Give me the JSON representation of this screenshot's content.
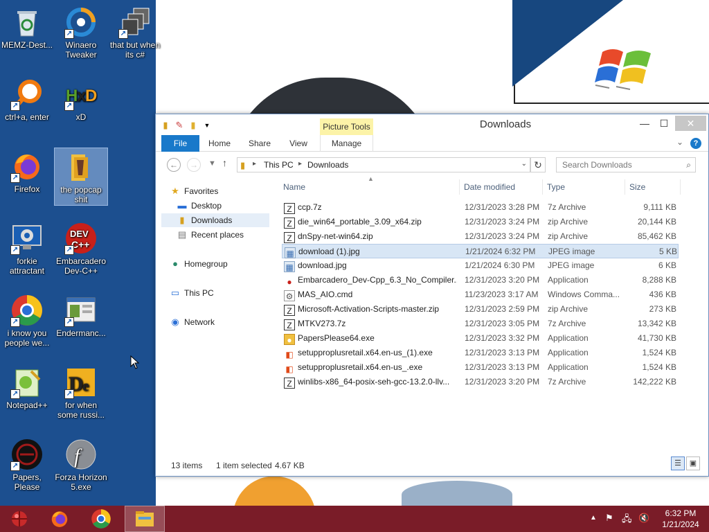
{
  "desktop_icons": [
    {
      "label": "MEMZ-Dest...",
      "icon": "recycle-bin-icon"
    },
    {
      "label": "Winaero Tweaker",
      "icon": "winaero-icon"
    },
    {
      "label": "that but when its c#",
      "icon": "windows-stack-icon"
    },
    {
      "label": "ctrl+a, enter",
      "icon": "magnifier-icon"
    },
    {
      "label": "xD",
      "icon": "hxd-icon"
    },
    {
      "label": "Firefox",
      "icon": "firefox-icon"
    },
    {
      "label": "the popcap shit",
      "icon": "folder-icon"
    },
    {
      "label": "forkie attractant",
      "icon": "settings-monitor-icon"
    },
    {
      "label": "Embarcadero Dev-C++",
      "icon": "devcpp-icon"
    },
    {
      "label": "i know you people we...",
      "icon": "chrome-icon"
    },
    {
      "label": "Endermanc...",
      "icon": "window-app-icon"
    },
    {
      "label": "Notepad++",
      "icon": "notepad-plus-icon"
    },
    {
      "label": "for when some russi...",
      "icon": "die-icon"
    },
    {
      "label": "Papers, Please",
      "icon": "papers-please-icon"
    },
    {
      "label": "Forza Horizon 5.exe",
      "icon": "flash-icon"
    }
  ],
  "explorer": {
    "title": "Downloads",
    "contextual_tab": "Picture Tools",
    "ribbon_tabs": [
      "File",
      "Home",
      "Share",
      "View",
      "Manage"
    ],
    "breadcrumb": [
      "This PC",
      "Downloads"
    ],
    "search_placeholder": "Search Downloads",
    "nav": {
      "favorites": "Favorites",
      "favorites_items": [
        "Desktop",
        "Downloads",
        "Recent places"
      ],
      "homegroup": "Homegroup",
      "this_pc": "This PC",
      "network": "Network"
    },
    "columns": [
      "Name",
      "Date modified",
      "Type",
      "Size"
    ],
    "files": [
      {
        "name": "ccp.7z",
        "date": "12/31/2023 3:28 PM",
        "type": "7z Archive",
        "size": "9,111 KB",
        "icon": "archive-icon"
      },
      {
        "name": "die_win64_portable_3.09_x64.zip",
        "date": "12/31/2023 3:24 PM",
        "type": "zip Archive",
        "size": "20,144 KB",
        "icon": "archive-icon"
      },
      {
        "name": "dnSpy-net-win64.zip",
        "date": "12/31/2023 3:24 PM",
        "type": "zip Archive",
        "size": "85,462 KB",
        "icon": "archive-icon"
      },
      {
        "name": "download (1).jpg",
        "date": "1/21/2024 6:32 PM",
        "type": "JPEG image",
        "size": "5 KB",
        "icon": "image-icon",
        "selected": true
      },
      {
        "name": "download.jpg",
        "date": "1/21/2024 6:30 PM",
        "type": "JPEG image",
        "size": "6 KB",
        "icon": "image-icon"
      },
      {
        "name": "Embarcadero_Dev-Cpp_6.3_No_Compiler...",
        "date": "12/31/2023 3:20 PM",
        "type": "Application",
        "size": "8,288 KB",
        "icon": "devcpp-app-icon"
      },
      {
        "name": "MAS_AIO.cmd",
        "date": "11/23/2023 3:17 AM",
        "type": "Windows Comma...",
        "size": "436 KB",
        "icon": "cmd-icon"
      },
      {
        "name": "Microsoft-Activation-Scripts-master.zip",
        "date": "12/31/2023 2:59 PM",
        "type": "zip Archive",
        "size": "273 KB",
        "icon": "archive-icon"
      },
      {
        "name": "MTKV273.7z",
        "date": "12/31/2023 3:05 PM",
        "type": "7z Archive",
        "size": "13,342 KB",
        "icon": "archive-icon"
      },
      {
        "name": "PapersPlease64.exe",
        "date": "12/31/2023 3:32 PM",
        "type": "Application",
        "size": "41,730 KB",
        "icon": "papers-app-icon"
      },
      {
        "name": "setupproplusretail.x64.en-us_(1).exe",
        "date": "12/31/2023 3:13 PM",
        "type": "Application",
        "size": "1,524 KB",
        "icon": "office-icon"
      },
      {
        "name": "setupproplusretail.x64.en-us_.exe",
        "date": "12/31/2023 3:13 PM",
        "type": "Application",
        "size": "1,524 KB",
        "icon": "office-icon"
      },
      {
        "name": "winlibs-x86_64-posix-seh-gcc-13.2.0-llv...",
        "date": "12/31/2023 3:20 PM",
        "type": "7z Archive",
        "size": "142,222 KB",
        "icon": "archive-icon"
      }
    ],
    "status_items": "13 items",
    "status_selected": "1 item selected",
    "status_size": "4.67 KB"
  },
  "taskbar": {
    "clock_time": "6:32 PM",
    "clock_date": "1/21/2024"
  },
  "colors": {
    "accent": "#1979ca",
    "taskbar": "#7a1c28",
    "desktop": "#1c4f8f",
    "selection": "#d8e6f5"
  }
}
